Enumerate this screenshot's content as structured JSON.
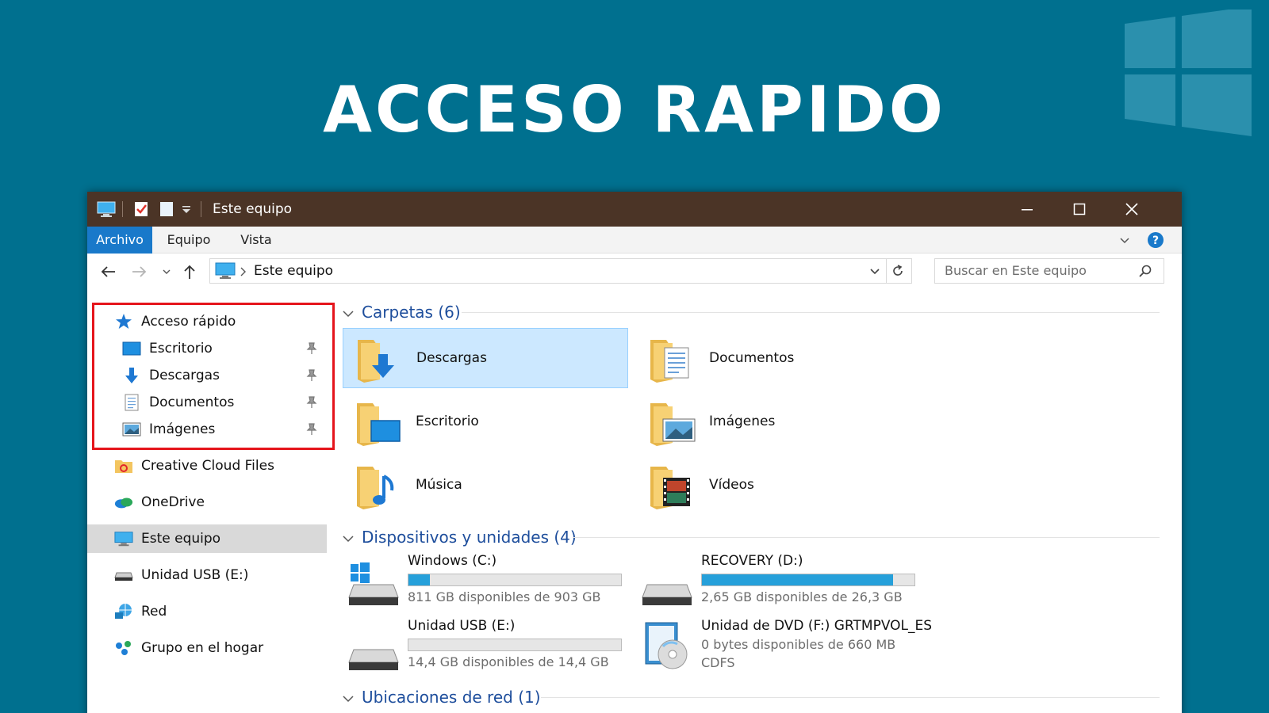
{
  "banner": {
    "title": "ACCESO RAPIDO"
  },
  "window": {
    "title": "Este equipo",
    "ribbon_tabs": [
      "Archivo",
      "Equipo",
      "Vista"
    ],
    "address": "Este equipo",
    "search_placeholder": "Buscar en Este equipo"
  },
  "sidebar": {
    "quick_access": "Acceso rápido",
    "pinned": [
      {
        "label": "Escritorio",
        "icon": "desktop-icon"
      },
      {
        "label": "Descargas",
        "icon": "download-icon"
      },
      {
        "label": "Documentos",
        "icon": "document-icon"
      },
      {
        "label": "Imágenes",
        "icon": "picture-icon"
      }
    ],
    "items": [
      {
        "label": "Creative Cloud Files",
        "icon": "creative-cloud-icon"
      },
      {
        "label": "OneDrive",
        "icon": "onedrive-icon"
      },
      {
        "label": "Este equipo",
        "icon": "computer-icon"
      },
      {
        "label": "Unidad USB (E:)",
        "icon": "usb-drive-icon"
      },
      {
        "label": "Red",
        "icon": "network-icon"
      },
      {
        "label": "Grupo en el hogar",
        "icon": "homegroup-icon"
      }
    ]
  },
  "content": {
    "folders_header": "Carpetas (6)",
    "folders": [
      {
        "label": "Descargas"
      },
      {
        "label": "Documentos"
      },
      {
        "label": "Escritorio"
      },
      {
        "label": "Imágenes"
      },
      {
        "label": "Música"
      },
      {
        "label": "Vídeos"
      }
    ],
    "devices_header": "Dispositivos y unidades (4)",
    "drives": [
      {
        "name": "Windows (C:)",
        "info": "811 GB disponibles de 903 GB",
        "used_fraction": 0.1
      },
      {
        "name": "RECOVERY (D:)",
        "info": "2,65 GB disponibles de 26,3 GB",
        "used_fraction": 0.9
      },
      {
        "name": "Unidad USB (E:)",
        "info": "14,4 GB disponibles de 14,4 GB",
        "used_fraction": 0.0
      },
      {
        "name": "Unidad de DVD (F:) GRTMPVOL_ES",
        "info": "0 bytes disponibles de 660 MB",
        "fs": "CDFS"
      }
    ],
    "network_header": "Ubicaciones de red (1)"
  },
  "colors": {
    "background": "#00708f",
    "titlebar": "#4b3426",
    "accent": "#1979ca",
    "drive_bar": "#26a0da",
    "highlight": "#e5151c"
  }
}
